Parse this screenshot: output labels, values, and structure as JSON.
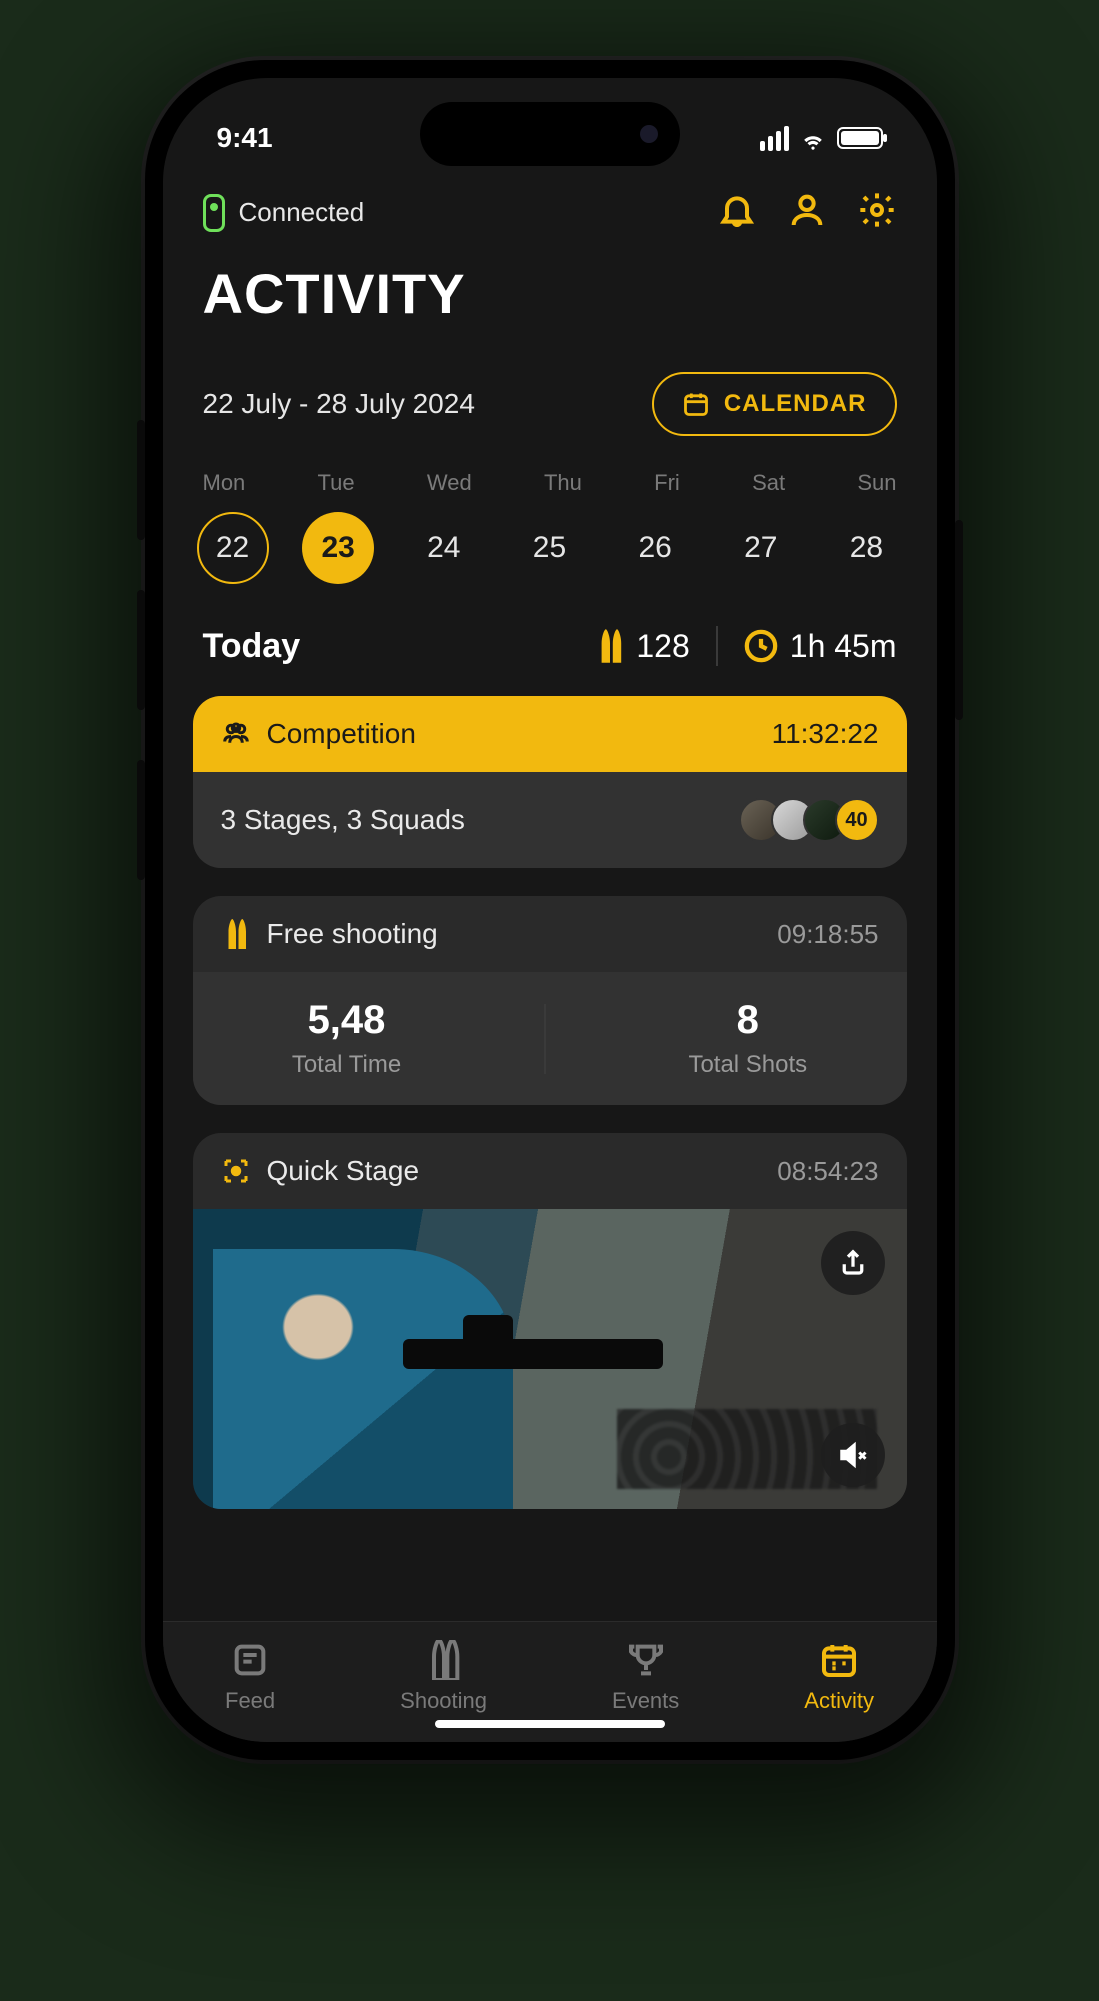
{
  "statusbar": {
    "time": "9:41"
  },
  "header": {
    "connection": "Connected",
    "title": "ACTIVITY"
  },
  "calendar": {
    "range": "22 July - 28 July 2024",
    "button": "CALENDAR",
    "days_short": [
      "Mon",
      "Tue",
      "Wed",
      "Thu",
      "Fri",
      "Sat",
      "Sun"
    ],
    "days_num": [
      "22",
      "23",
      "24",
      "25",
      "26",
      "27",
      "28"
    ]
  },
  "today": {
    "label": "Today",
    "shots": "128",
    "time": "1h 45m"
  },
  "competition": {
    "title": "Competition",
    "time": "11:32:22",
    "detail": "3 Stages, 3 Squads",
    "extra_count": "40"
  },
  "free_shooting": {
    "title": "Free shooting",
    "time": "09:18:55",
    "total_time": "5,48",
    "total_time_label": "Total Time",
    "total_shots": "8",
    "total_shots_label": "Total Shots"
  },
  "quick_stage": {
    "title": "Quick Stage",
    "time": "08:54:23"
  },
  "nav": {
    "feed": "Feed",
    "shooting": "Shooting",
    "events": "Events",
    "activity": "Activity"
  }
}
